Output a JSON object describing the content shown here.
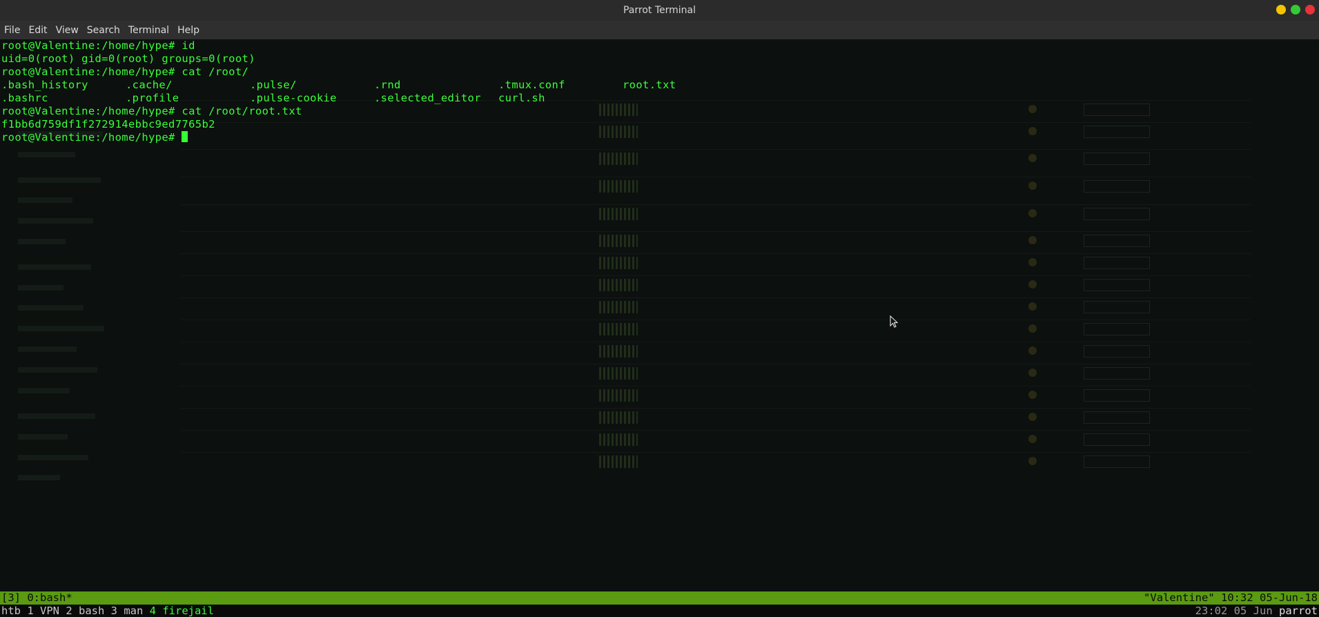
{
  "window": {
    "title": "Parrot Terminal",
    "controls": [
      {
        "name": "minimize",
        "color": "#f5c400"
      },
      {
        "name": "maximize",
        "color": "#37c837"
      },
      {
        "name": "close",
        "color": "#e8333a"
      }
    ]
  },
  "menu": [
    "File",
    "Edit",
    "View",
    "Search",
    "Terminal",
    "Help"
  ],
  "terminal": {
    "lines": [
      "root@Valentine:/home/hype# id",
      "uid=0(root) gid=0(root) groups=0(root)",
      "root@Valentine:/home/hype# cat /root/"
    ],
    "ls_rows": [
      [
        ".bash_history",
        ".cache/",
        ".pulse/",
        ".rnd",
        ".tmux.conf",
        "root.txt"
      ],
      [
        ".bashrc",
        ".profile",
        ".pulse-cookie",
        ".selected_editor",
        "curl.sh",
        ""
      ]
    ],
    "lines_after": [
      "root@Valentine:/home/hype# cat /root/root.txt",
      "f1bb6d759df1f272914ebbc9ed7765b2"
    ],
    "prompt": "root@Valentine:/home/hype# ",
    "text_color": "#3aff3a"
  },
  "tmux": {
    "left": "[3] 0:bash*",
    "right": "\"Valentine\" 10:32 05-Jun-18",
    "bg_color": "#5a9b12"
  },
  "windows": {
    "items": [
      "htb",
      "1 VPN",
      "2 bash",
      "3 man"
    ],
    "active": "4 firejail",
    "clock": "23:02 05 Jun",
    "host": "parrot"
  }
}
